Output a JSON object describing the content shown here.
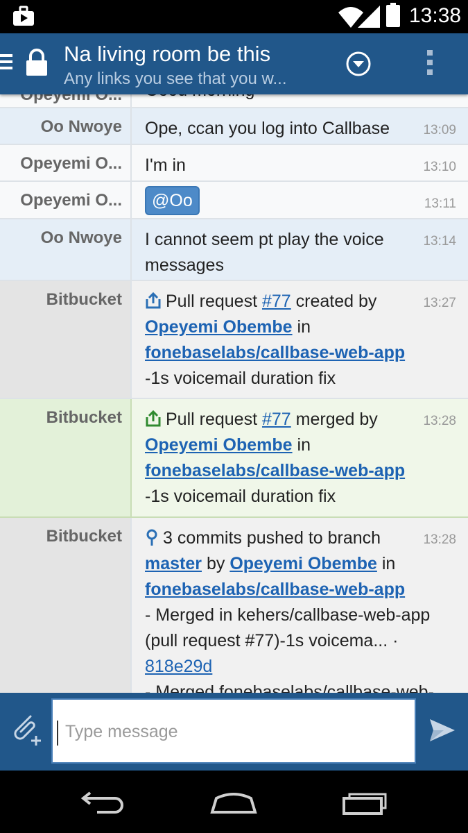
{
  "status_bar": {
    "time": "13:38"
  },
  "header": {
    "title": "Na living room be this",
    "subtitle": "Any links you see that you w..."
  },
  "messages": [
    {
      "sender": "Opeyemi O...",
      "text": "Good morning",
      "time": ""
    },
    {
      "sender": "Oo Nwoye",
      "text": "Ope, ccan you log into Callbase",
      "time": "13:09"
    },
    {
      "sender": "Opeyemi O...",
      "text": "I'm in",
      "time": "13:10"
    },
    {
      "sender": "Opeyemi O...",
      "mention": "@Oo",
      "time": "13:11"
    },
    {
      "sender": "Oo Nwoye",
      "text": "I cannot seem pt play the voice messages",
      "time": "13:14"
    },
    {
      "sender": "Bitbucket",
      "time": "13:27",
      "pre": "Pull request",
      "pr": "#77",
      "action": "created by",
      "author": "Opeyemi Obembe",
      "in": "in",
      "repo": "fonebaselabs/callbase-web-app",
      "desc": "-1s voicemail duration fix"
    },
    {
      "sender": "Bitbucket",
      "time": "13:28",
      "pre": "Pull request",
      "pr": "#77",
      "action": "merged by",
      "author": "Opeyemi Obembe",
      "in": "in",
      "repo": "fonebaselabs/callbase-web-app",
      "desc": "-1s voicemail duration fix"
    },
    {
      "sender": "Bitbucket",
      "time": "13:28",
      "pre": "3 commits pushed to branch",
      "branch": "master",
      "by": "by",
      "author": "Opeyemi Obembe",
      "in": "in",
      "repo": "fonebaselabs/callbase-web-app",
      "commit_text": "- Merged in kehers/callbase-web-app (pull request #77)-1s voicema... ·",
      "commit_hash": "818e29d",
      "next_text": "- Merged fonebaselabs/callbase-web-app"
    }
  ],
  "composer": {
    "placeholder": "Type message"
  },
  "colors": {
    "header": "#21578a",
    "link": "#1d63b3",
    "mention": "#4d8ac8",
    "merged_bg": "#f0f7e9"
  },
  "icons": [
    "notification-icon",
    "wifi-icon",
    "signal-icon",
    "battery-icon",
    "menu-icon",
    "lock-icon",
    "chevron-down-circle-icon",
    "overflow-menu-icon",
    "share-icon",
    "commit-icon",
    "attach-icon",
    "send-icon",
    "back-icon",
    "home-icon",
    "recents-icon"
  ]
}
